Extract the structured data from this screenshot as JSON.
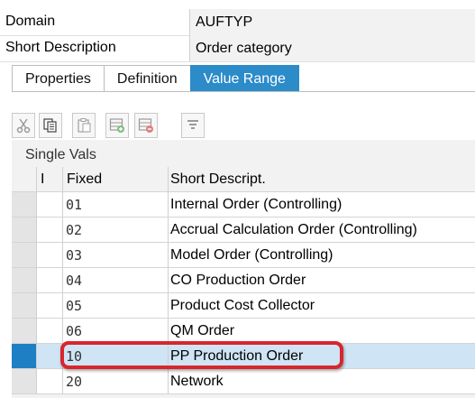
{
  "header": {
    "domain_label": "Domain",
    "domain_value": "AUFTYP",
    "short_desc_label": "Short Description",
    "short_desc_value": "Order category"
  },
  "tabs": [
    {
      "label": "Properties",
      "active": false
    },
    {
      "label": "Definition",
      "active": false
    },
    {
      "label": "Value Range",
      "active": true
    }
  ],
  "toolbar": {
    "buttons": [
      "cut-icon",
      "copy-icon",
      "paste-icon",
      "insert-row-icon",
      "delete-row-icon",
      "filter-icon"
    ]
  },
  "single_vals": {
    "title": "Single Vals",
    "columns": {
      "indicator": "I",
      "fixed": "Fixed",
      "description": "Short Descript."
    },
    "rows": [
      {
        "fixed": "01",
        "description": "Internal Order (Controlling)"
      },
      {
        "fixed": "02",
        "description": "Accrual Calculation Order (Controlling)"
      },
      {
        "fixed": "03",
        "description": "Model Order (Controlling)"
      },
      {
        "fixed": "04",
        "description": "CO Production Order"
      },
      {
        "fixed": "05",
        "description": "Product Cost Collector"
      },
      {
        "fixed": "06",
        "description": "QM Order"
      },
      {
        "fixed": "10",
        "description": "PP Production Order",
        "selected": true
      },
      {
        "fixed": "20",
        "description": "Network"
      }
    ]
  },
  "colors": {
    "tab_active": "#2c8bc9",
    "row_selected": "#cfe4f5",
    "selector_selected": "#1f7fc4",
    "highlight_outline": "#d8262c"
  }
}
